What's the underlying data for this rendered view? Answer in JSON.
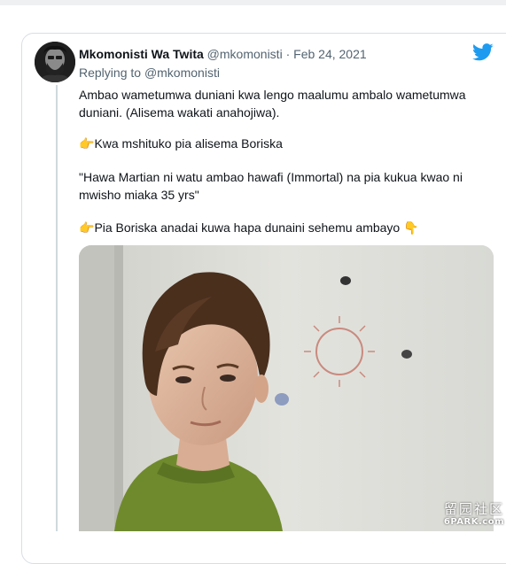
{
  "tweet": {
    "display_name": "Mkomonisti Wa Twita",
    "handle": "@mkomonisti",
    "separator": "·",
    "date": "Feb 24, 2021",
    "replying_prefix": "Replying to",
    "replying_handle": "@mkomonisti",
    "paragraphs": [
      "Ambao wametumwa duniani kwa lengo maalumu ambalo wametumwa duniani. (Alisema wakati anahojiwa).",
      "Kwa mshituko pia alisema Boriska",
      "\"Hawa Martian ni watu ambao hawafi (Immortal) na pia kukua kwao ni mwisho miaka 35 yrs\"",
      "Pia Boriska anadai kuwa hapa dunaini sehemu ambayo"
    ],
    "pointing_right_emoji": "👉",
    "pointing_down_emoji": "👇",
    "media_icon": "photo-of-boy",
    "brand_icon": "twitter-bird-icon"
  },
  "watermark": {
    "main": "留园社区",
    "sub": "6PARK.com"
  },
  "colors": {
    "twitter_blue": "#1d9bf0",
    "text_primary": "#0f1419",
    "text_secondary": "#536471",
    "border": "#d9dee2"
  }
}
